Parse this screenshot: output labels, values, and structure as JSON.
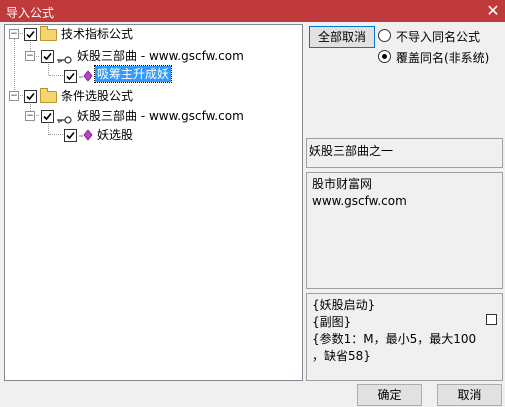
{
  "window": {
    "title": "导入公式",
    "close": "✕"
  },
  "tree": {
    "node1": {
      "label": "技术指标公式"
    },
    "node1_child": {
      "label": "妖股三部曲 - www.gscfw.com"
    },
    "node1_leaf": {
      "label": "吸筹主升成妖"
    },
    "node2": {
      "label": "条件选股公式"
    },
    "node2_child": {
      "label": "妖股三部曲 - www.gscfw.com"
    },
    "node2_leaf": {
      "label": "妖选股"
    }
  },
  "options": {
    "cancel_all": "全部取消",
    "no_import_same": "不导入同名公式",
    "overwrite_same": "覆盖同名(非系统)"
  },
  "panels": {
    "desc": "妖股三部曲之一",
    "source_line1": "股市财富网",
    "source_line2": "www.gscfw.com",
    "formula_lines": [
      "{妖股启动}",
      "{副图}",
      "{参数1：M，最小5，最大100",
      "，缺省58}"
    ]
  },
  "footer": {
    "ok": "确定",
    "cancel": "取消"
  }
}
